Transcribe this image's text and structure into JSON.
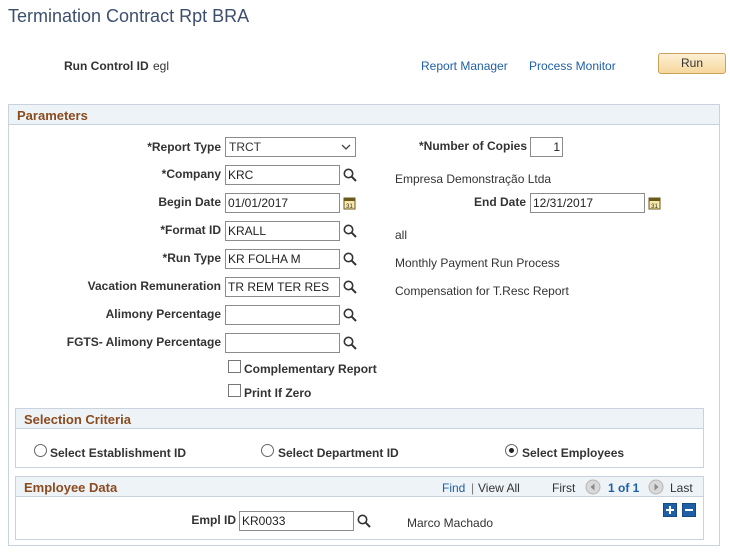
{
  "page": {
    "title": "Termination Contract Rpt BRA"
  },
  "header": {
    "run_control_label": "Run Control ID",
    "run_control_value": "egl",
    "report_manager": "Report Manager",
    "process_monitor": "Process Monitor",
    "run_button": "Run"
  },
  "parameters": {
    "title": "Parameters",
    "report_type_label": "*Report Type",
    "report_type_value": "TRCT",
    "copies_label": "*Number of Copies",
    "copies_value": "1",
    "company_label": "*Company",
    "company_value": "KRC",
    "company_desc": "Empresa Demonstração Ltda",
    "begin_date_label": "Begin Date",
    "begin_date_value": "01/01/2017",
    "end_date_label": "End Date",
    "end_date_value": "12/31/2017",
    "format_id_label": "*Format ID",
    "format_id_value": "KRALL",
    "format_id_desc": "all",
    "run_type_label": "*Run Type",
    "run_type_value": "KR FOLHA M",
    "run_type_desc": "Monthly Payment Run Process",
    "vacation_label": "Vacation Remuneration",
    "vacation_value": "TR REM TER RES",
    "vacation_desc": "Compensation for T.Resc Report",
    "alimony_label": "Alimony Percentage",
    "alimony_value": "",
    "fgts_label": "FGTS- Alimony Percentage",
    "fgts_value": "",
    "complementary_label": "Complementary Report",
    "print_zero_label": "Print If Zero"
  },
  "selection": {
    "title": "Selection Criteria",
    "establishment_label": "Select Establishment ID",
    "department_label": "Select Department ID",
    "employees_label": "Select Employees",
    "selected": "employees"
  },
  "employee": {
    "title": "Employee Data",
    "find": "Find",
    "separator": "|",
    "view_all": "View All",
    "first": "First",
    "pager": "1 of 1",
    "last": "Last",
    "empl_id_label": "Empl ID",
    "empl_id_value": "KR0033",
    "empl_name": "Marco Machado"
  }
}
